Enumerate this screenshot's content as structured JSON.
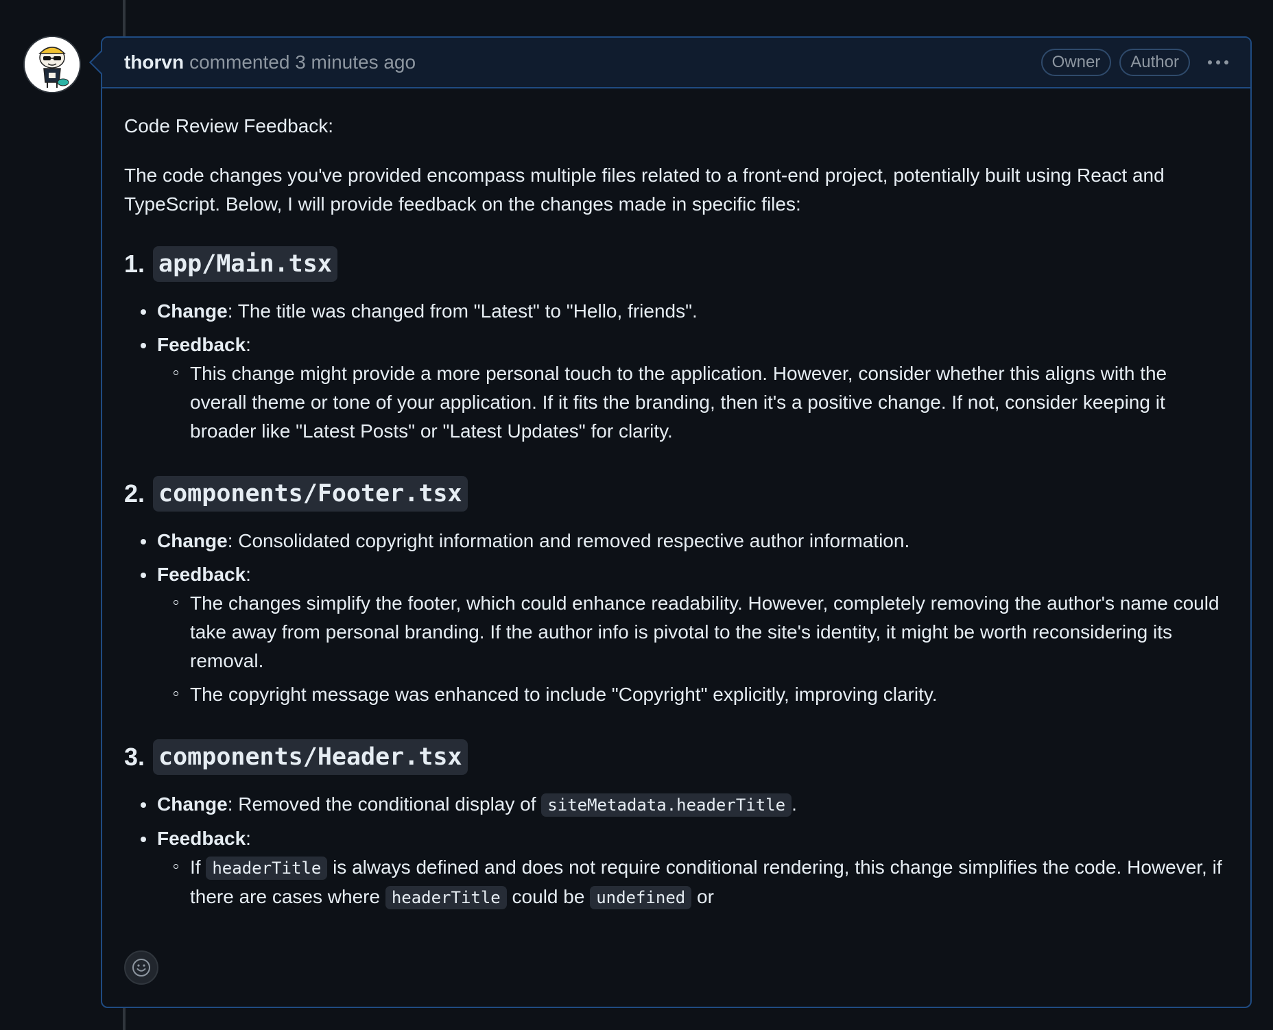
{
  "comment": {
    "author": "thorvn",
    "action": "commented",
    "time": "3 minutes ago",
    "badges": [
      "Owner",
      "Author"
    ],
    "menu_icon": "kebab-horizontal-icon",
    "avatar_icon": "avatar-cartoon-icon"
  },
  "body": {
    "title": "Code Review Feedback:",
    "intro": "The code changes you've provided encompass multiple files related to a front-end project, potentially built using React and TypeScript. Below, I will provide feedback on the changes made in specific files:",
    "sections": [
      {
        "number": "1.",
        "file": "app/Main.tsx",
        "change_label": "Change",
        "change_text": ": The title was changed from \"Latest\" to \"Hello, friends\".",
        "feedback_label": "Feedback",
        "feedback_colon": ":",
        "feedback_items": [
          "This change might provide a more personal touch to the application. However, consider whether this aligns with the overall theme or tone of your application. If it fits the branding, then it's a positive change. If not, consider keeping it broader like \"Latest Posts\" or \"Latest Updates\" for clarity."
        ]
      },
      {
        "number": "2.",
        "file": "components/Footer.tsx",
        "change_label": "Change",
        "change_text": ": Consolidated copyright information and removed respective author information.",
        "feedback_label": "Feedback",
        "feedback_colon": ":",
        "feedback_items": [
          "The changes simplify the footer, which could enhance readability. However, completely removing the author's name could take away from personal branding. If the author info is pivotal to the site's identity, it might be worth reconsidering its removal.",
          "The copyright message was enhanced to include \"Copyright\" explicitly, improving clarity."
        ]
      },
      {
        "number": "3.",
        "file": "components/Header.tsx",
        "change_label": "Change",
        "change_prefix": ": Removed the conditional display of ",
        "change_code": "siteMetadata.headerTitle",
        "change_suffix": ".",
        "feedback_label": "Feedback",
        "feedback_colon": ":",
        "feedback_item": {
          "t1": "If ",
          "c1": "headerTitle",
          "t2": " is always defined and does not require conditional rendering, this change simplifies the code. However, if there are cases where ",
          "c2": "headerTitle",
          "t3": " could be ",
          "c3": "undefined",
          "t4": " or"
        }
      }
    ]
  },
  "footer": {
    "reaction_icon": "smiley-icon"
  }
}
